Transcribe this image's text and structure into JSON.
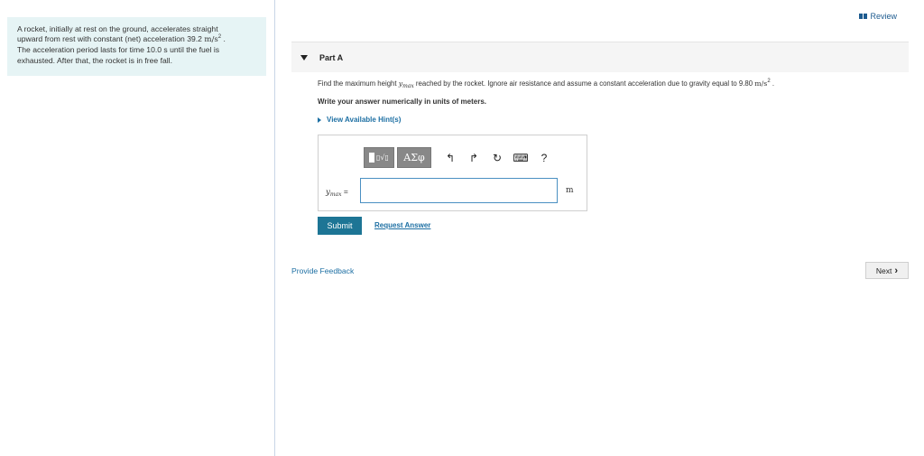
{
  "problem": {
    "line1": "A rocket, initially at rest on the ground, accelerates straight",
    "line2_pre": "upward from rest with constant (net) acceleration 39.2 ",
    "line2_unit": "m/s",
    "line2_exp": "2",
    "line2_post": " .",
    "line3": "The acceleration period lasts for time 10.0 s until the fuel is",
    "line4": "exhausted. After that, the rocket is in free fall."
  },
  "header": {
    "review_label": "Review"
  },
  "part": {
    "title": "Part A",
    "question_pre": "Find the maximum height ",
    "question_var": "y",
    "question_var_sub": "max",
    "question_mid": " reached by the rocket. Ignore air resistance and assume a constant acceleration due to gravity equal to 9.80 ",
    "question_unit": "m/s",
    "question_exp": "2",
    "question_post": " .",
    "instruction": "Write your answer numerically in units of meters.",
    "hints_label": "View Available Hint(s)"
  },
  "toolbar": {
    "greek_label": "ΑΣφ",
    "undo_icon": "↰",
    "redo_icon": "↱",
    "reset_icon": "↻",
    "keyboard_icon": "⌨",
    "help_label": "?"
  },
  "answer": {
    "var": "y",
    "var_sub": "max",
    "equals": " =",
    "value": "",
    "unit": "m"
  },
  "actions": {
    "submit_label": "Submit",
    "request_answer_label": "Request Answer",
    "feedback_label": "Provide Feedback",
    "next_label": "Next"
  }
}
